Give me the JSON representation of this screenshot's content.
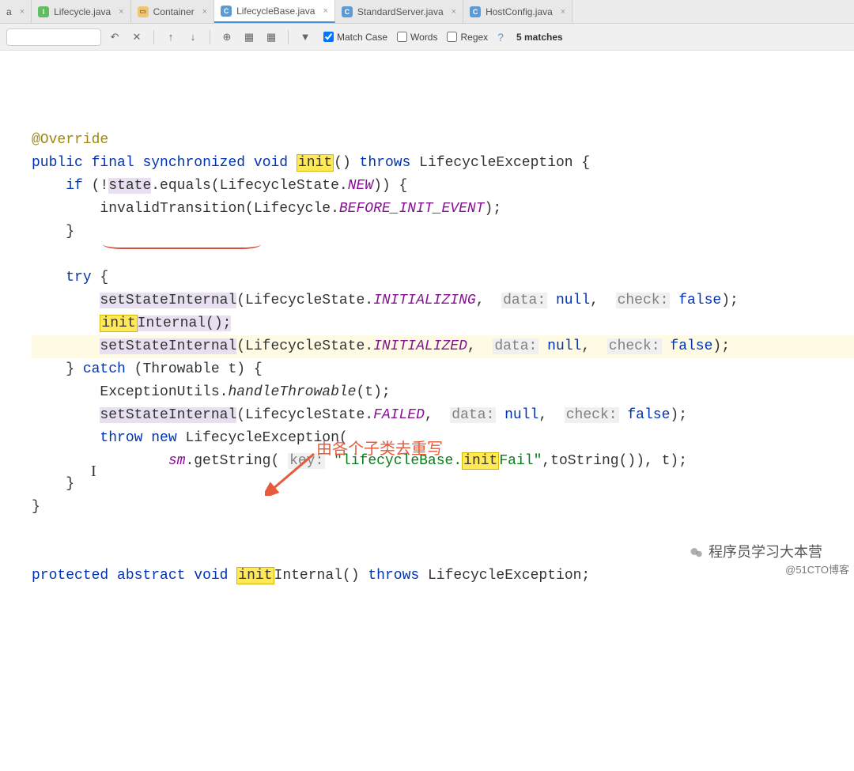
{
  "tabs": [
    {
      "label": "a",
      "icon": "",
      "truncated": true
    },
    {
      "label": "Lifecycle.java",
      "icon": "I"
    },
    {
      "label": "Container",
      "icon": "□"
    },
    {
      "label": "LifecycleBase.java",
      "icon": "C",
      "active": true
    },
    {
      "label": "StandardServer.java",
      "icon": "C"
    },
    {
      "label": "HostConfig.java",
      "icon": "C"
    }
  ],
  "toolbar": {
    "match_case": "Match Case",
    "words": "Words",
    "regex": "Regex",
    "matches": "5 matches"
  },
  "code": {
    "override": "@Override",
    "public": "public",
    "final": "final",
    "synchronized": "synchronized",
    "void": "void",
    "init": "init",
    "throws": "throws",
    "lifecycleException": "LifecycleException",
    "if": "if",
    "state": "state",
    "equals": ".equals(LifecycleState.",
    "NEW": "NEW",
    "invalidTransition": "invalidTransition(Lifecycle.",
    "BEFORE_INIT_EVENT": "BEFORE_INIT_EVENT",
    "try": "try",
    "setStateInternal": "setStateInternal",
    "lifecycleState": "(LifecycleState.",
    "INITIALIZING": "INITIALIZING",
    "INITIALIZED": "INITIALIZED",
    "FAILED": "FAILED",
    "data": "data:",
    "check": "check:",
    "null": "null",
    "false": "false",
    "initInternal": "Internal();",
    "catch": "catch",
    "throwable": "(Throwable t) {",
    "exceptionUtils": "ExceptionUtils.",
    "handleThrowable": "handleThrowable",
    "throw": "throw",
    "new": "new",
    "sm": "sm",
    "getString": ".getString(",
    "key": "key:",
    "lifecycleBaseString": "\"lifecycleBase.",
    "fail": "Fail\"",
    "toString": ",toString()), t);",
    "protected": "protected",
    "abstract": "abstract",
    "internal2": "Internal()"
  },
  "annotation": "由各个子类去重写",
  "watermark_top": "程序员学习大本营",
  "watermark": "@51CTO博客"
}
